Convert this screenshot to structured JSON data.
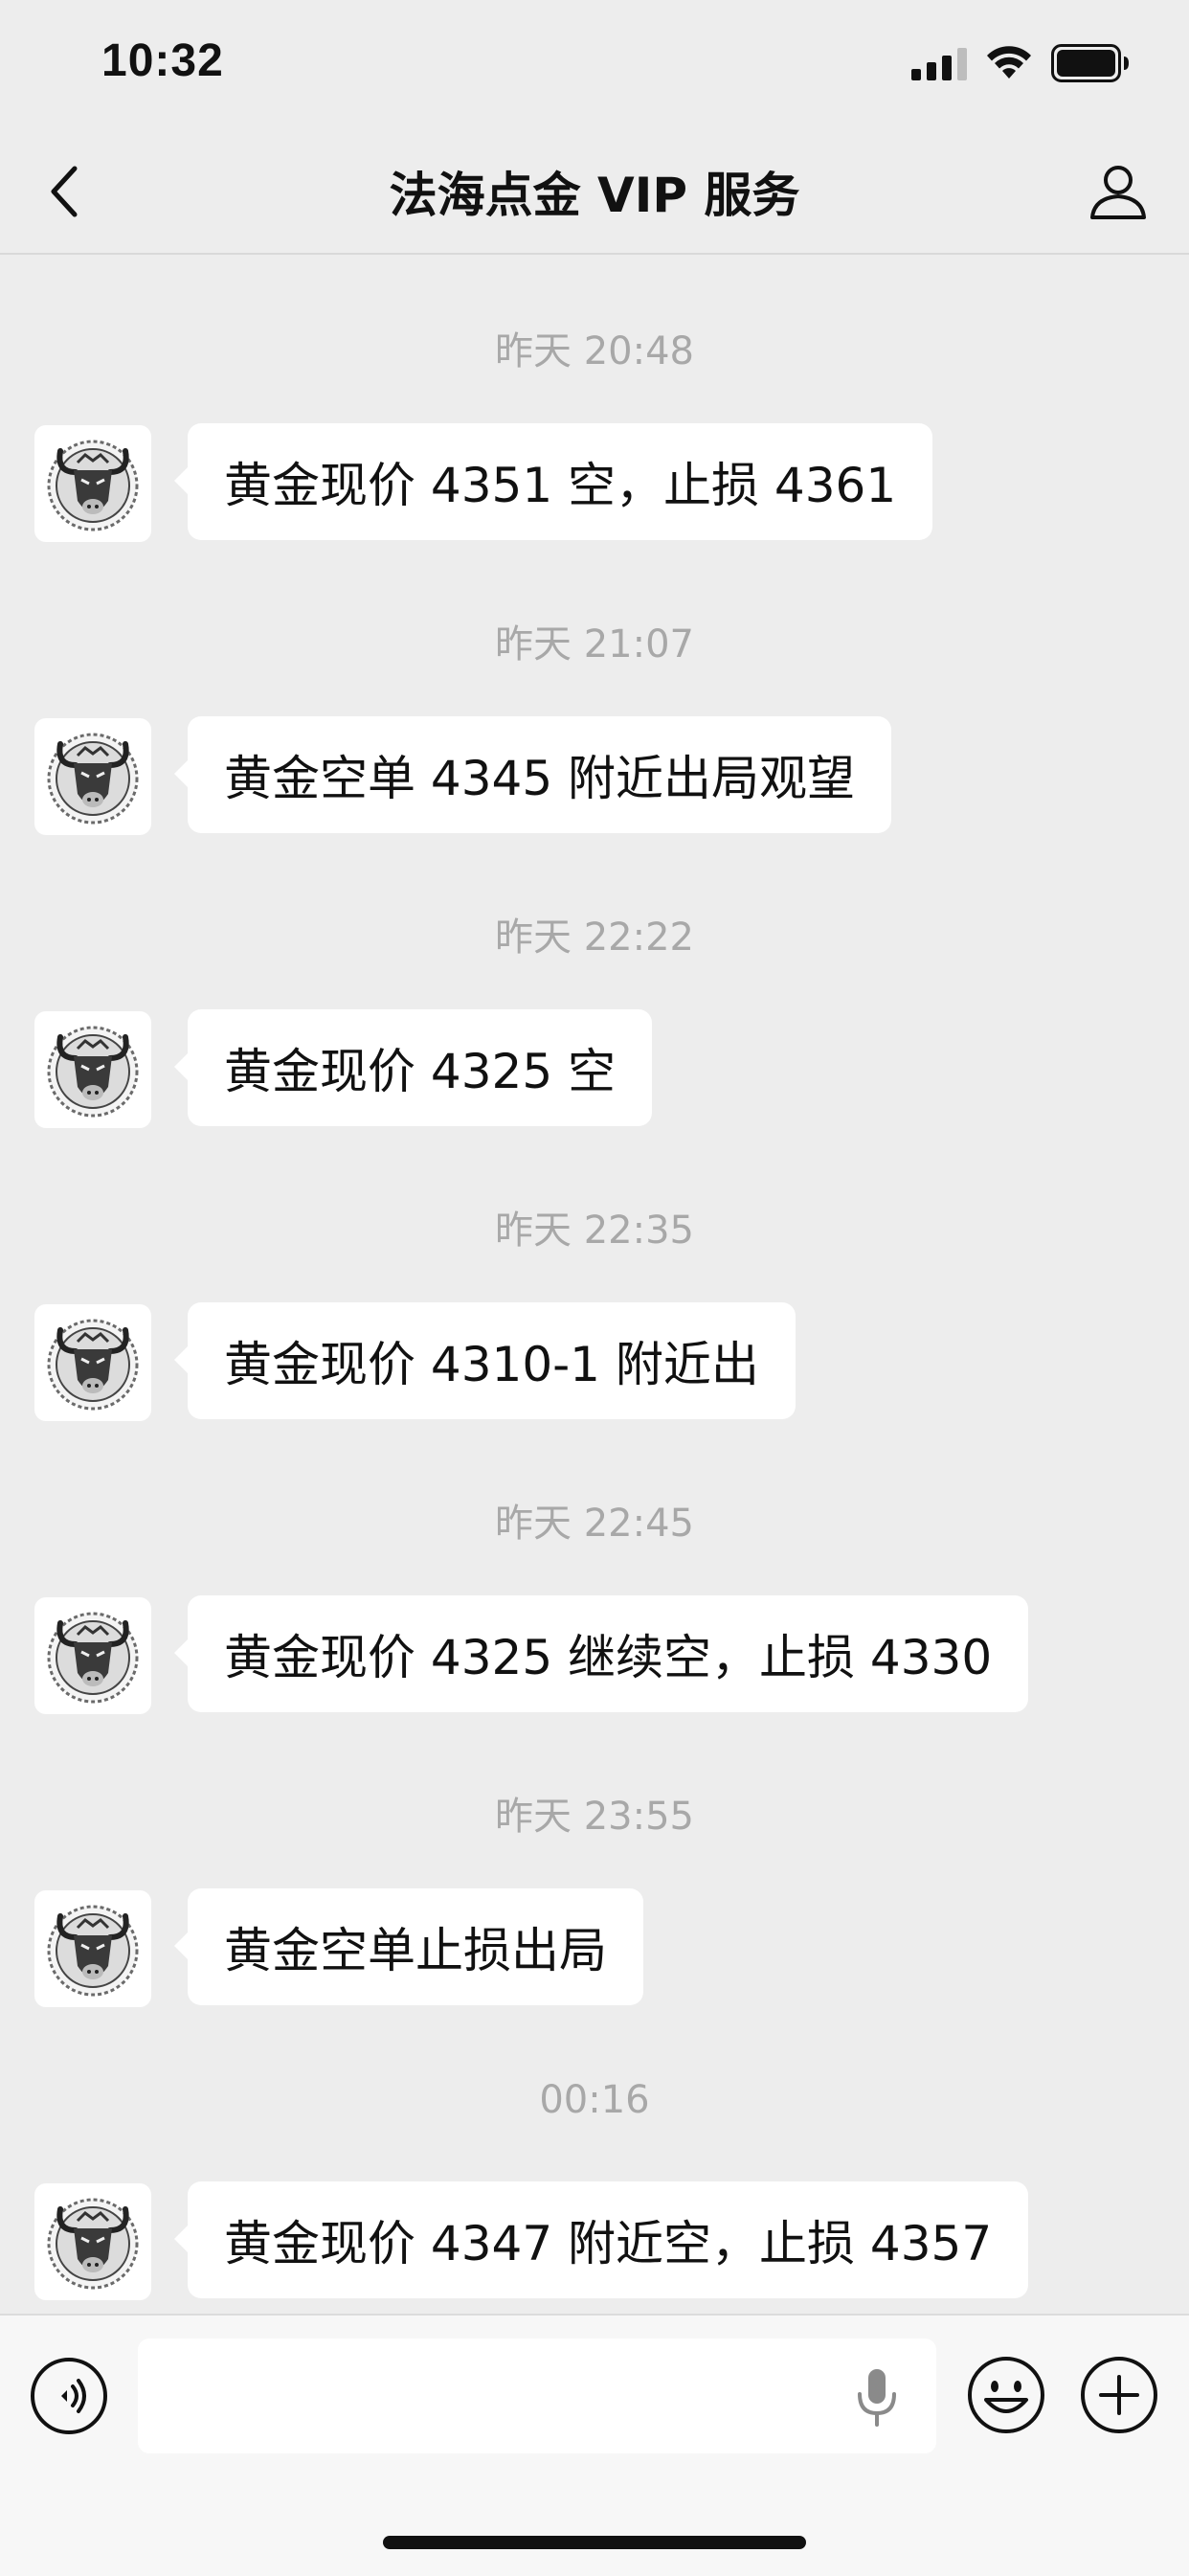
{
  "status_bar": {
    "time": "10:32"
  },
  "header": {
    "title": "法海点金 VIP 服务",
    "back_icon": "chevron-left-icon",
    "profile_icon": "person-icon"
  },
  "messages": [
    {
      "timestamp": "昨天 20:48",
      "text": "黄金现价 4351 空，止损 4361"
    },
    {
      "timestamp": "昨天 21:07",
      "text": "黄金空单 4345 附近出局观望"
    },
    {
      "timestamp": "昨天 22:22",
      "text": "黄金现价 4325 空"
    },
    {
      "timestamp": "昨天 22:35",
      "text": "黄金现价 4310-1 附近出"
    },
    {
      "timestamp": "昨天 22:45",
      "text": "黄金现价 4325 继续空，止损 4330"
    },
    {
      "timestamp": "昨天 23:55",
      "text": "黄金空单止损出局"
    },
    {
      "timestamp": "00:16",
      "text": "黄金现价 4347 附近空，止损 4357"
    }
  ],
  "input_bar": {
    "value": "",
    "voice_icon": "voice-icon",
    "mic_icon": "microphone-icon",
    "emoji_icon": "emoji-icon",
    "plus_icon": "plus-icon"
  },
  "colors": {
    "background": "#ededed",
    "bubble": "#ffffff",
    "timestamp": "#a8a8a8",
    "text": "#111111"
  }
}
